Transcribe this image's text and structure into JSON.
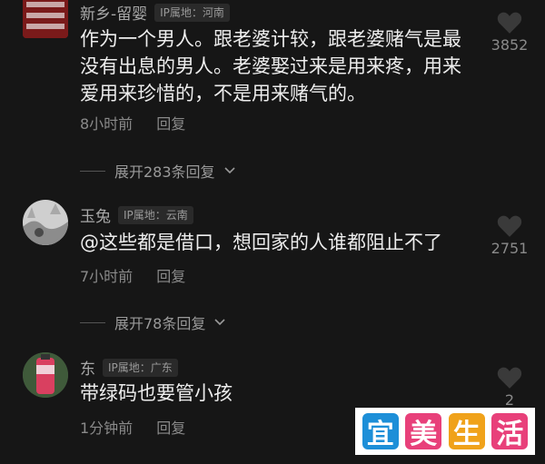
{
  "comments": [
    {
      "name": "新乡-留婴",
      "ip": "IP属地：河南",
      "text": "作为一个男人。跟老婆计较，跟老婆赌气是最没有出息的男人。老婆娶过来是用来疼，用来爱用来珍惜的，不是用来赌气的。",
      "time": "8小时前",
      "reply": "回复",
      "likes": "3852",
      "expand": "展开283条回复"
    },
    {
      "name": "玉兔",
      "ip": "IP属地：云南",
      "text": "@这些都是借口，想回家的人谁都阻止不了",
      "time": "7小时前",
      "reply": "回复",
      "likes": "2751",
      "expand": "展开78条回复"
    },
    {
      "name": "东",
      "ip": "IP属地：广东",
      "text": "带绿码也要管小孩",
      "time": "1分钟前",
      "reply": "回复",
      "likes": "2"
    }
  ],
  "watermark": [
    "宜",
    "美",
    "生",
    "活"
  ],
  "colors": {
    "background": "#161616",
    "watermark_1": "#1d8fd8",
    "watermark_2": "#e8407a",
    "watermark_3": "#f0a21a",
    "watermark_4": "#e8407a"
  }
}
